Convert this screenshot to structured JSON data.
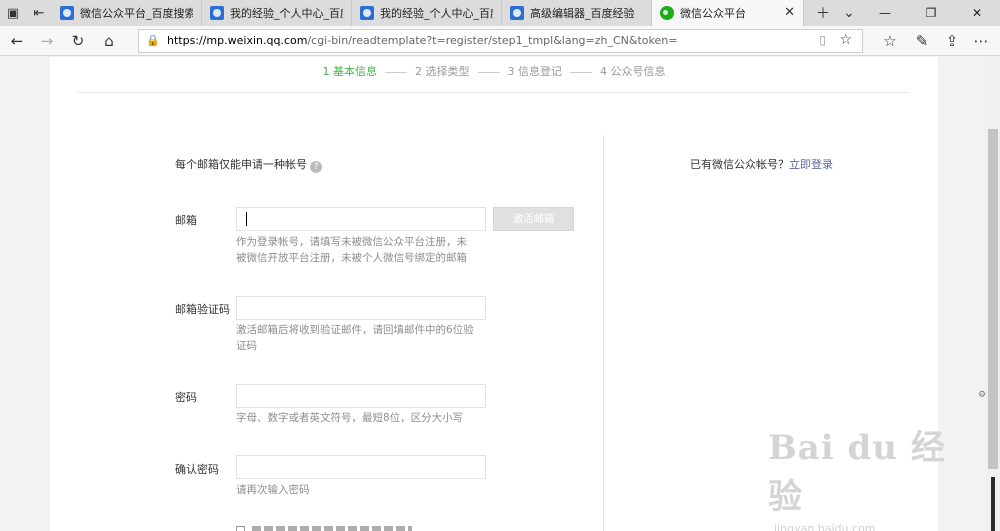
{
  "browser": {
    "tabs": [
      {
        "title": "微信公众平台_百度搜索",
        "favicon": "baidu",
        "active": false
      },
      {
        "title": "我的经验_个人中心_百度经验",
        "favicon": "baidu",
        "active": false
      },
      {
        "title": "我的经验_个人中心_百度经验",
        "favicon": "baidu",
        "active": false
      },
      {
        "title": "高级编辑器_百度经验",
        "favicon": "baidu",
        "active": false
      },
      {
        "title": "微信公众平台",
        "favicon": "wechat",
        "active": true
      }
    ],
    "url": {
      "host": "https://mp.weixin.qq.com",
      "path": "/cgi-bin/readtemplate?t=register/step1_tmpl&lang=zh_CN&token="
    },
    "accent_color": "#44b549",
    "link_color": "#576b95"
  },
  "steps": [
    {
      "label": "1 基本信息",
      "current": true
    },
    {
      "label": "2 选择类型",
      "current": false
    },
    {
      "label": "3 信息登记",
      "current": false
    },
    {
      "label": "4 公众号信息",
      "current": false
    }
  ],
  "form": {
    "notice": "每个邮箱仅能申请一种帐号",
    "email": {
      "label": "邮箱",
      "value": "",
      "activate_button": "激活邮箱",
      "hint": "作为登录帐号，请填写未被微信公众平台注册，未被微信开放平台注册，未被个人微信号绑定的邮箱"
    },
    "code": {
      "label": "邮箱验证码",
      "value": "",
      "hint": "激活邮箱后将收到验证邮件，请回填邮件中的6位验证码"
    },
    "password": {
      "label": "密码",
      "value": "",
      "hint": "字母、数字或者英文符号，最短8位，区分大小写"
    },
    "confirm": {
      "label": "确认密码",
      "value": "",
      "hint": "请再次输入密码"
    }
  },
  "side": {
    "have_account": "已有微信公众帐号？",
    "login_link": "立即登录"
  },
  "watermark": {
    "logo": "Bai du 经验",
    "sub": "jingyan.baidu.com"
  }
}
